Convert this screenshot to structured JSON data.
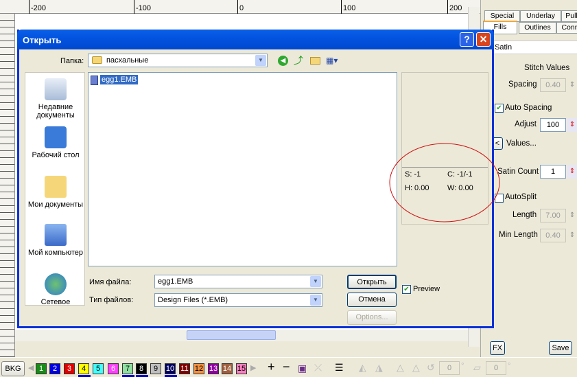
{
  "ruler": {
    "ticks": [
      "-200",
      "-100",
      "0",
      "100",
      "200"
    ]
  },
  "dialog": {
    "title": "Открыть",
    "folder_label": "Папка:",
    "folder_value": "пасхальные",
    "places": [
      "Недавние документы",
      "Рабочий стол",
      "Мои документы",
      "Мой компьютер",
      "Сетевое"
    ],
    "files": [
      "egg1.EMB"
    ],
    "preview_info": {
      "s": "S: -1",
      "c": "C: -1/-1",
      "h": "H: 0.00",
      "w": "W: 0.00"
    },
    "filename_label": "Имя файла:",
    "filename_value": "egg1.EMB",
    "filetype_label": "Тип файлов:",
    "filetype_value": "Design Files (*.EMB)",
    "open_button": "Открыть",
    "cancel_button": "Отмена",
    "options_button": "Options...",
    "preview_checkbox": "Preview",
    "help_button": "?",
    "close_button": "✕"
  },
  "panel": {
    "tabs_row1": [
      "Special",
      "Underlay",
      "Pull"
    ],
    "tabs_row2": [
      "Fills",
      "Outlines",
      "Conn"
    ],
    "fill_type": "Satin",
    "stitch_values": "Stitch Values",
    "spacing_label": "Spacing",
    "spacing_value": "0.40",
    "auto_spacing": "Auto Spacing",
    "adjust_label": "Adjust",
    "adjust_value": "100",
    "values_button": "Values...",
    "satin_count_label": "Satin Count",
    "satin_count_value": "1",
    "autosplit": "AutoSplit",
    "length_label": "Length",
    "length_value": "7.00",
    "min_length_label": "Min Length",
    "min_length_value": "0.40",
    "fx_button": "FX",
    "save_button": "Save"
  },
  "toolbar": {
    "bkg": "BKG",
    "swatches": [
      {
        "n": "1",
        "c": "#1a8a1a",
        "t": "#fff"
      },
      {
        "n": "2",
        "c": "#0000e0",
        "t": "#fff"
      },
      {
        "n": "3",
        "c": "#e00000",
        "t": "#fff"
      },
      {
        "n": "4",
        "c": "#ffff00",
        "t": "#000"
      },
      {
        "n": "5",
        "c": "#40ffff",
        "t": "#000"
      },
      {
        "n": "6",
        "c": "#ff40ff",
        "t": "#fff"
      },
      {
        "n": "7",
        "c": "#90e0a0",
        "t": "#000"
      },
      {
        "n": "8",
        "c": "#000000",
        "t": "#fff"
      },
      {
        "n": "9",
        "c": "#c0c0c0",
        "t": "#000"
      },
      {
        "n": "10",
        "c": "#000060",
        "t": "#fff"
      },
      {
        "n": "11",
        "c": "#800000",
        "t": "#fff"
      },
      {
        "n": "12",
        "c": "#f09040",
        "t": "#000"
      },
      {
        "n": "13",
        "c": "#9000a0",
        "t": "#fff"
      },
      {
        "n": "14",
        "c": "#a06040",
        "t": "#fff"
      },
      {
        "n": "15",
        "c": "#ff80c0",
        "t": "#000"
      }
    ],
    "rotate_value": "0",
    "slant_value": "0"
  }
}
